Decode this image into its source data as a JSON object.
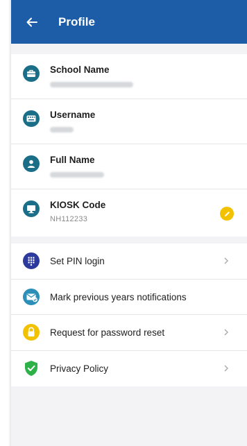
{
  "appbar": {
    "title": "Profile",
    "back_icon": "arrow-left-icon",
    "color": "#1d5da8"
  },
  "profile": {
    "school_name": {
      "label": "School Name",
      "icon": "briefcase-icon"
    },
    "username": {
      "label": "Username",
      "icon": "keyboard-icon"
    },
    "full_name": {
      "label": "Full Name",
      "icon": "person-icon"
    },
    "kiosk_code": {
      "label": "KIOSK Code",
      "value": "NH112233",
      "icon": "monitor-icon",
      "edit_icon": "pencil-icon"
    },
    "icon_color": "#1a6e87",
    "edit_color": "#f2c200"
  },
  "menu": {
    "set_pin": {
      "label": "Set PIN login",
      "icon": "keypad-icon",
      "color": "#2b3a9c"
    },
    "mark_notifications": {
      "label": "Mark previous years notifications",
      "icon": "mail-check-icon",
      "color": "#2b8fb8"
    },
    "password_reset": {
      "label": "Request for password reset",
      "icon": "lock-icon",
      "color": "#f2c200"
    },
    "privacy_policy": {
      "label": "Privacy Policy",
      "icon": "shield-check-icon",
      "color": "#2fb14a"
    }
  }
}
